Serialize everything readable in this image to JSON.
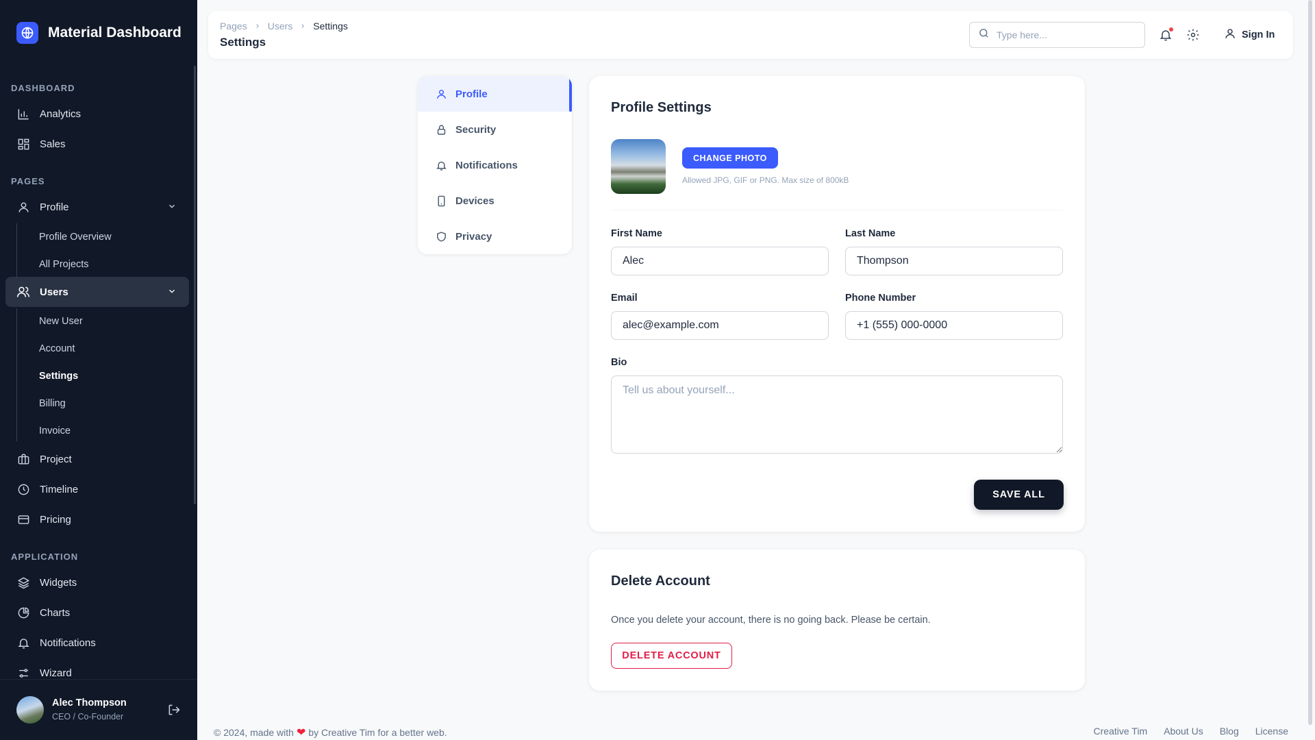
{
  "app": {
    "title": "Material Dashboard"
  },
  "sidebar": {
    "sections": {
      "dashboard": "DASHBOARD",
      "pages": "PAGES",
      "application": "APPLICATION"
    },
    "dashboard_items": [
      {
        "label": "Analytics",
        "icon": "bar-chart-icon"
      },
      {
        "label": "Sales",
        "icon": "grid-icon"
      }
    ],
    "profile": {
      "label": "Profile",
      "icon": "user-icon",
      "sub": [
        "Profile Overview",
        "All Projects"
      ]
    },
    "users": {
      "label": "Users",
      "icon": "users-icon",
      "sub": [
        "New User",
        "Account",
        "Settings",
        "Billing",
        "Invoice"
      ],
      "current": "Settings"
    },
    "page_items": [
      {
        "label": "Project",
        "icon": "briefcase-icon"
      },
      {
        "label": "Timeline",
        "icon": "clock-icon"
      },
      {
        "label": "Pricing",
        "icon": "credit-card-icon"
      }
    ],
    "application_items": [
      {
        "label": "Widgets",
        "icon": "layers-icon"
      },
      {
        "label": "Charts",
        "icon": "pie-chart-icon"
      },
      {
        "label": "Notifications",
        "icon": "bell-icon"
      },
      {
        "label": "Wizard",
        "icon": "sliders-icon"
      }
    ],
    "user": {
      "name": "Alec Thompson",
      "role": "CEO / Co-Founder"
    }
  },
  "topbar": {
    "breadcrumb": [
      "Pages",
      "Users",
      "Settings"
    ],
    "title": "Settings",
    "search_placeholder": "Type here...",
    "sign_in": "Sign In"
  },
  "settings_nav": [
    {
      "label": "Profile",
      "icon": "user-icon",
      "active": true
    },
    {
      "label": "Security",
      "icon": "lock-icon"
    },
    {
      "label": "Notifications",
      "icon": "bell-icon"
    },
    {
      "label": "Devices",
      "icon": "smartphone-icon"
    },
    {
      "label": "Privacy",
      "icon": "shield-icon"
    }
  ],
  "profile_settings": {
    "title": "Profile Settings",
    "change_photo": "CHANGE PHOTO",
    "photo_hint": "Allowed JPG, GIF or PNG. Max size of 800kB",
    "first_name": {
      "label": "First Name",
      "value": "Alec"
    },
    "last_name": {
      "label": "Last Name",
      "value": "Thompson"
    },
    "email": {
      "label": "Email",
      "value": "alec@example.com"
    },
    "phone": {
      "label": "Phone Number",
      "value": "+1 (555) 000-0000"
    },
    "bio": {
      "label": "Bio",
      "placeholder": "Tell us about yourself..."
    },
    "save": "SAVE ALL"
  },
  "delete_account": {
    "title": "Delete Account",
    "text": "Once you delete your account, there is no going back. Please be certain.",
    "button": "DELETE ACCOUNT"
  },
  "footer": {
    "prefix": "© 2024, made with",
    "suffix": "by Creative Tim for a better web.",
    "links": [
      "Creative Tim",
      "About Us",
      "Blog",
      "License"
    ]
  },
  "colors": {
    "sidebar_bg": "#111827",
    "accent": "#3b5bfd",
    "danger": "#e11d48",
    "notif_dot": "#ef4444"
  }
}
